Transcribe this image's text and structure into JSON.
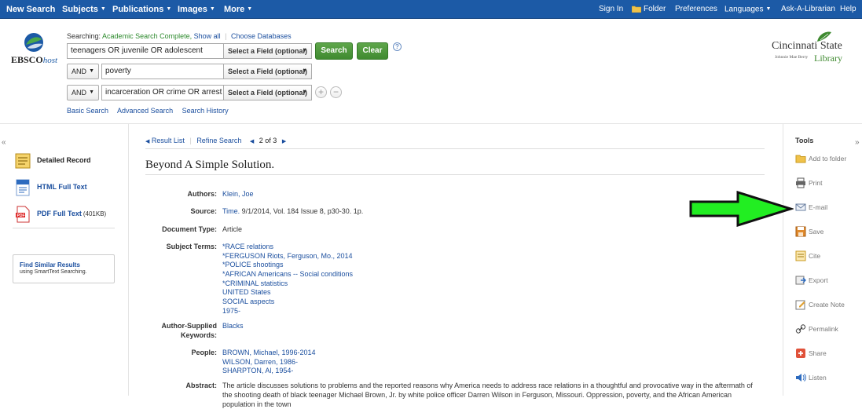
{
  "topnav": {
    "left": [
      "New Search",
      "Subjects",
      "Publications",
      "Images",
      "More"
    ],
    "right": [
      "Sign In",
      "Folder",
      "Preferences",
      "Languages",
      "Ask-A-Librarian",
      "Help"
    ]
  },
  "logo": {
    "text_a": "EBSCO",
    "text_b": "host"
  },
  "searching": {
    "label": "Searching:",
    "db": "Academic Search Complete,",
    "show_all": "Show all",
    "choose": "Choose Databases"
  },
  "search_rows": [
    {
      "bool": "",
      "query": "teenagers OR juvenile OR adolescent",
      "field": "Select a Field (optional)"
    },
    {
      "bool": "AND",
      "query": "poverty",
      "field": "Select a Field (optional)"
    },
    {
      "bool": "AND",
      "query": "incarceration OR crime OR arrest",
      "field": "Select a Field (optional)"
    }
  ],
  "buttons": {
    "search": "Search",
    "clear": "Clear",
    "help": "?",
    "add": "+",
    "remove": "−"
  },
  "sublinks": [
    "Basic Search",
    "Advanced Search",
    "Search History"
  ],
  "library": {
    "name": "Cincinnati State",
    "sub_a": "Johnnie Mae Berry",
    "sub_b": "Library"
  },
  "collapse": {
    "left": "«",
    "right": "»"
  },
  "formats": [
    {
      "label": "Detailed Record",
      "size": ""
    },
    {
      "label": "HTML Full Text",
      "size": ""
    },
    {
      "label": "PDF Full Text",
      "size": "(401KB)"
    }
  ],
  "similar": {
    "title": "Find Similar Results",
    "sub": "using SmartText Searching."
  },
  "nav": {
    "result_list": "Result List",
    "refine": "Refine Search",
    "count": "2 of 3"
  },
  "record": {
    "title": "Beyond A Simple Solution.",
    "authors_label": "Authors:",
    "authors": "Klein, Joe",
    "source_label": "Source:",
    "source_link": "Time.",
    "source_rest": " 9/1/2014, Vol. 184 Issue 8, p30-30. 1p.",
    "doctype_label": "Document Type:",
    "doctype": "Article",
    "subjects_label": "Subject Terms:",
    "subjects": [
      "*RACE relations",
      "*FERGUSON Riots, Ferguson, Mo., 2014",
      "*POLICE shootings",
      "*AFRICAN Americans -- Social conditions",
      "*CRIMINAL statistics",
      "UNITED States",
      "SOCIAL aspects",
      "1975-"
    ],
    "keywords_label_a": "Author-Supplied",
    "keywords_label_b": "Keywords:",
    "keywords": "Blacks",
    "people_label": "People:",
    "people": [
      "BROWN, Michael, 1996-2014",
      "WILSON, Darren, 1986-",
      "SHARPTON, Al, 1954-"
    ],
    "abstract_label": "Abstract:",
    "abstract": "The article discusses solutions to problems and the reported reasons why America needs to address race relations in a thoughtful and provocative way in the aftermath of the shooting death of black teenager Michael Brown, Jr. by white police officer Darren Wilson in Ferguson, Missouri. Oppression, poverty, and the African American population in the town"
  },
  "tools": {
    "heading": "Tools",
    "items": [
      "Add to folder",
      "Print",
      "E-mail",
      "Save",
      "Cite",
      "Export",
      "Create Note",
      "Permalink",
      "Share",
      "Listen"
    ]
  },
  "colors": {
    "nav": "#1c5aa6",
    "accent_green": "#3f8a30",
    "arrow": "#22ee22",
    "link": "#1a4e9e"
  }
}
